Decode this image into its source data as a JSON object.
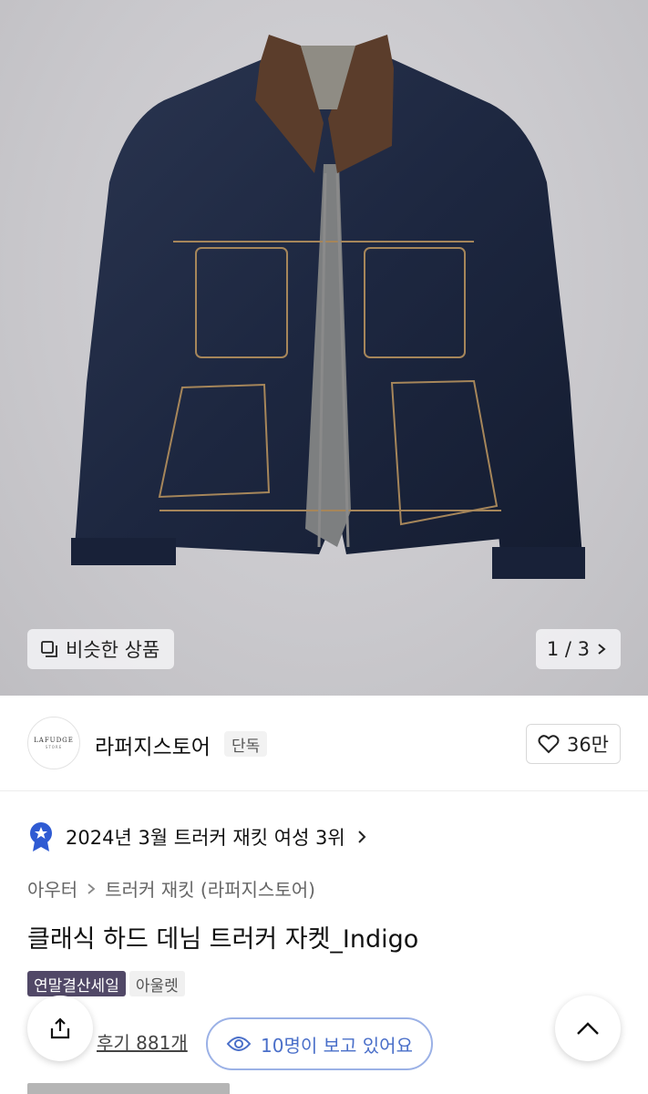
{
  "gallery": {
    "similar_label": "비슷한 상품",
    "pager_label": "1 / 3"
  },
  "brand": {
    "logo_text": "LAFUDGE",
    "logo_subtext": "STORE",
    "name": "라퍼지스토어",
    "tag": "단독",
    "likes": "36만"
  },
  "ranking": {
    "text": "2024년 3월 트러커 재킷 여성 3위"
  },
  "breadcrumb": {
    "category": "아우터",
    "subcategory": "트러커 재킷 (라퍼지스토어)"
  },
  "product": {
    "title": "클래식 하드 데님 트러커 자켓_Indigo",
    "tags": [
      "연말결산세일",
      "아울렛"
    ],
    "reviews": "후기 881개",
    "viewers": "10명이 보고 있어요"
  },
  "colors": {
    "sale_tag": "#514867",
    "viewer_accent": "#4a6fc9",
    "rank_badge": "#2f5bd3"
  }
}
